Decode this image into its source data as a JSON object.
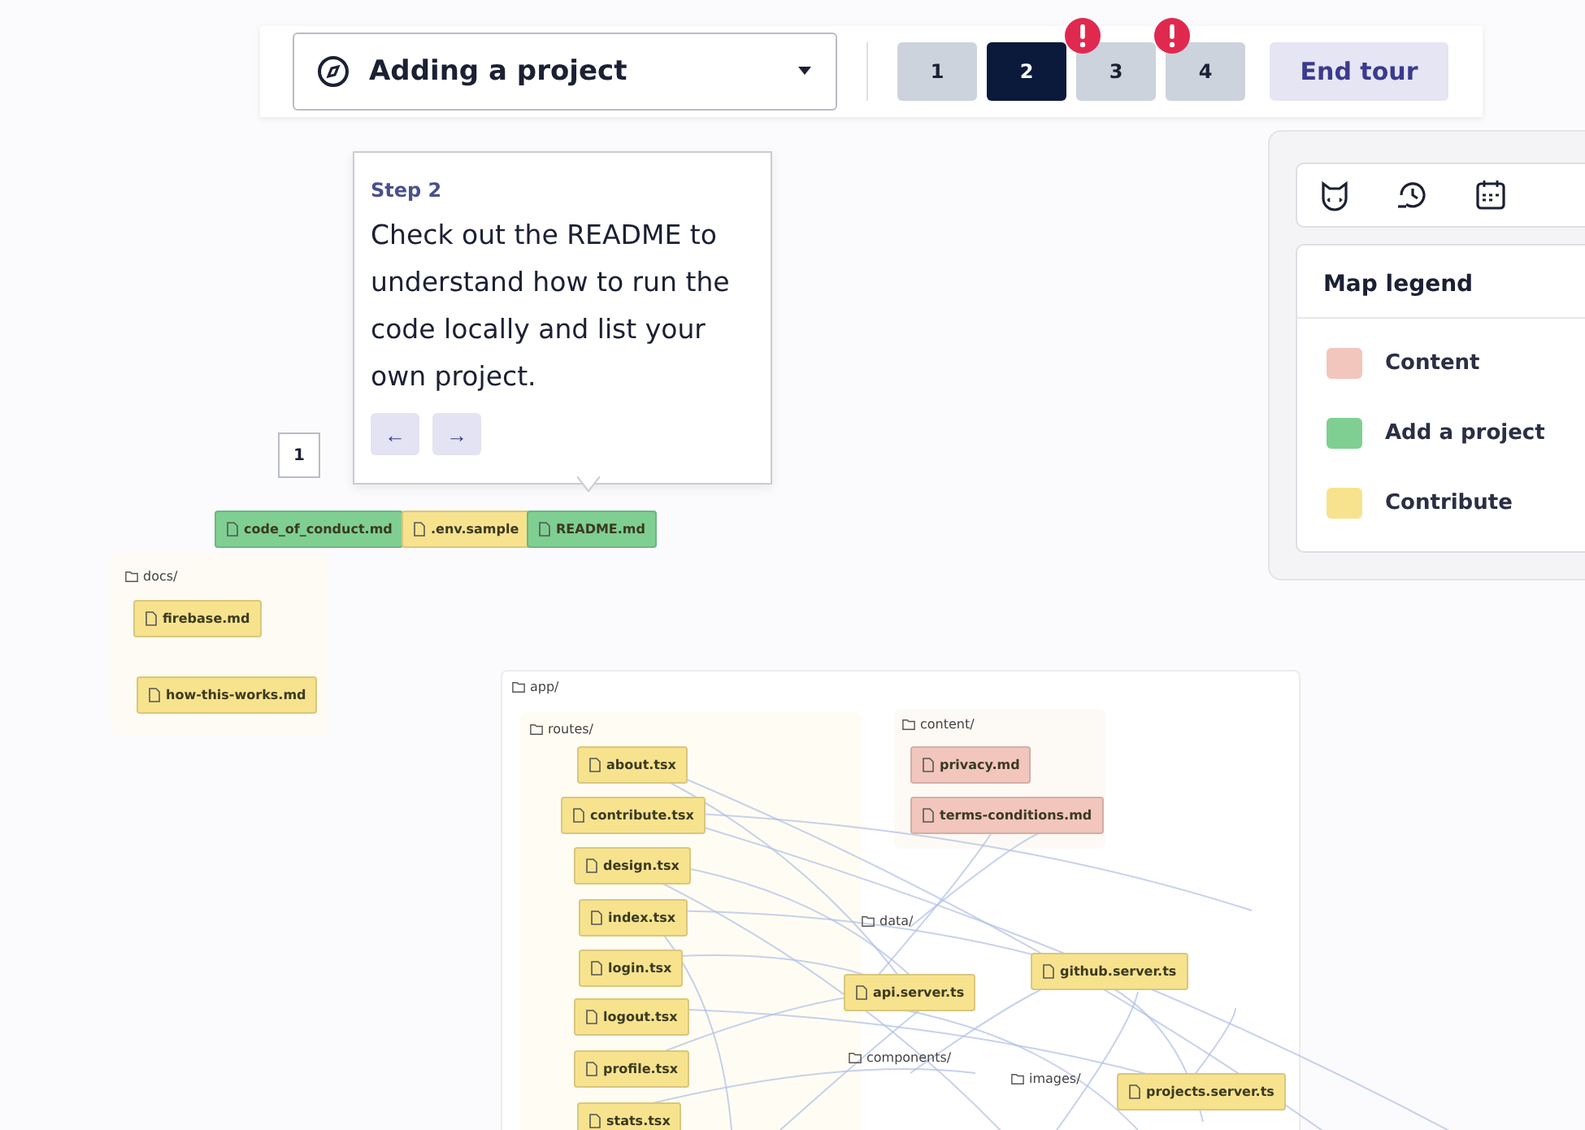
{
  "tour": {
    "title": "Adding a project",
    "steps": [
      {
        "label": "1",
        "selected": false,
        "alert": false
      },
      {
        "label": "2",
        "selected": true,
        "alert": false
      },
      {
        "label": "3",
        "selected": false,
        "alert": true
      },
      {
        "label": "4",
        "selected": false,
        "alert": true
      }
    ],
    "end_button": "End tour"
  },
  "tooltip": {
    "step": "Step 2",
    "text": "Check out the README to understand how to run the code locally and list your own project.",
    "prev": "←",
    "next": "→"
  },
  "marker": "1",
  "legend": {
    "title": "Map legend",
    "items": [
      {
        "label": "Content",
        "color": "#f2c6bd"
      },
      {
        "label": "Add a project",
        "color": "#7fcf92"
      },
      {
        "label": "Contribute",
        "color": "#f7e38e"
      }
    ]
  },
  "map": {
    "nodes": [
      {
        "kind": "file",
        "label": "code_of_conduct.md",
        "color": "#7fcf92"
      },
      {
        "kind": "file",
        "label": ".env.sample",
        "color": "#f7e38e"
      },
      {
        "kind": "file",
        "label": "README.md",
        "color": "#7fcf92"
      },
      {
        "kind": "folder",
        "label": "docs/"
      },
      {
        "kind": "file",
        "label": "firebase.md",
        "color": "#f7e38e"
      },
      {
        "kind": "file",
        "label": "how-this-works.md",
        "color": "#f7e38e"
      },
      {
        "kind": "folder",
        "label": "app/"
      },
      {
        "kind": "folder",
        "label": "routes/"
      },
      {
        "kind": "file",
        "label": "about.tsx",
        "color": "#f7e38e"
      },
      {
        "kind": "file",
        "label": "contribute.tsx",
        "color": "#f7e38e"
      },
      {
        "kind": "file",
        "label": "design.tsx",
        "color": "#f7e38e"
      },
      {
        "kind": "file",
        "label": "index.tsx",
        "color": "#f7e38e"
      },
      {
        "kind": "file",
        "label": "login.tsx",
        "color": "#f7e38e"
      },
      {
        "kind": "file",
        "label": "logout.tsx",
        "color": "#f7e38e"
      },
      {
        "kind": "file",
        "label": "profile.tsx",
        "color": "#f7e38e"
      },
      {
        "kind": "file",
        "label": "stats.tsx",
        "color": "#f7e38e"
      },
      {
        "kind": "folder",
        "label": "content/"
      },
      {
        "kind": "file",
        "label": "privacy.md",
        "color": "#f2c6bd"
      },
      {
        "kind": "file",
        "label": "terms-conditions.md",
        "color": "#f2c6bd"
      },
      {
        "kind": "folder",
        "label": "data/"
      },
      {
        "kind": "file",
        "label": "api.server.ts",
        "color": "#f7e38e"
      },
      {
        "kind": "file",
        "label": "github.server.ts",
        "color": "#f7e38e"
      },
      {
        "kind": "folder",
        "label": "components/"
      },
      {
        "kind": "folder",
        "label": "images/"
      },
      {
        "kind": "file",
        "label": "projects.server.ts",
        "color": "#f7e38e"
      }
    ]
  }
}
